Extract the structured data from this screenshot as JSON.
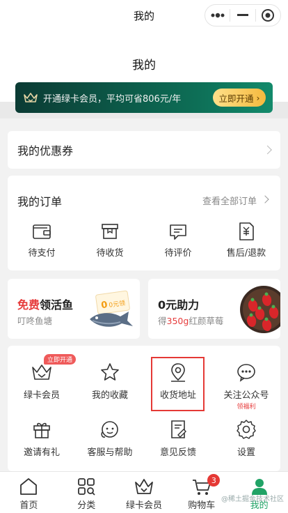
{
  "nav": {
    "title": "我的"
  },
  "header": {
    "title": "我的"
  },
  "vip_banner": {
    "text": "开通绿卡会员，平均可省806元/年",
    "button": "立即开通",
    "accent": "#0d6e56",
    "button_color": "#f5b93e"
  },
  "coupon": {
    "label": "我的优惠券"
  },
  "orders": {
    "title": "我的订单",
    "view_all": "查看全部订单",
    "items": [
      {
        "label": "待支付",
        "icon": "wallet-icon"
      },
      {
        "label": "待收货",
        "icon": "package-icon"
      },
      {
        "label": "待评价",
        "icon": "comment-icon"
      },
      {
        "label": "售后/退款",
        "icon": "refund-icon"
      }
    ]
  },
  "promos": {
    "fish": {
      "title_red": "免费",
      "title_rest": "领活鱼",
      "subtitle": "叮咚鱼塘",
      "tag": "0元领"
    },
    "help": {
      "title": "0元助力",
      "sub_prefix": "得",
      "sub_red": "350g",
      "sub_suffix": "红颜草莓"
    }
  },
  "services": [
    {
      "label": "绿卡会员",
      "icon": "crown-icon",
      "badge": "立即开通"
    },
    {
      "label": "我的收藏",
      "icon": "star-icon"
    },
    {
      "label": "收货地址",
      "icon": "location-pin-icon"
    },
    {
      "label": "关注公众号",
      "icon": "wechat-icon",
      "sub": "领福利"
    },
    {
      "label": "邀请有礼",
      "icon": "gift-icon"
    },
    {
      "label": "客服与帮助",
      "icon": "headset-icon"
    },
    {
      "label": "意见反馈",
      "icon": "feedback-icon"
    },
    {
      "label": "设置",
      "icon": "gear-icon"
    }
  ],
  "tabbar": [
    {
      "label": "首页",
      "icon": "home-icon"
    },
    {
      "label": "分类",
      "icon": "category-icon"
    },
    {
      "label": "绿卡会员",
      "icon": "crown-icon"
    },
    {
      "label": "购物车",
      "icon": "cart-icon",
      "badge": "3"
    },
    {
      "label": "我的",
      "icon": "user-icon",
      "active": true
    }
  ],
  "watermark": "@稀土掘金技术社区",
  "colors": {
    "active_green": "#21a366",
    "badge_red": "#e53935"
  }
}
